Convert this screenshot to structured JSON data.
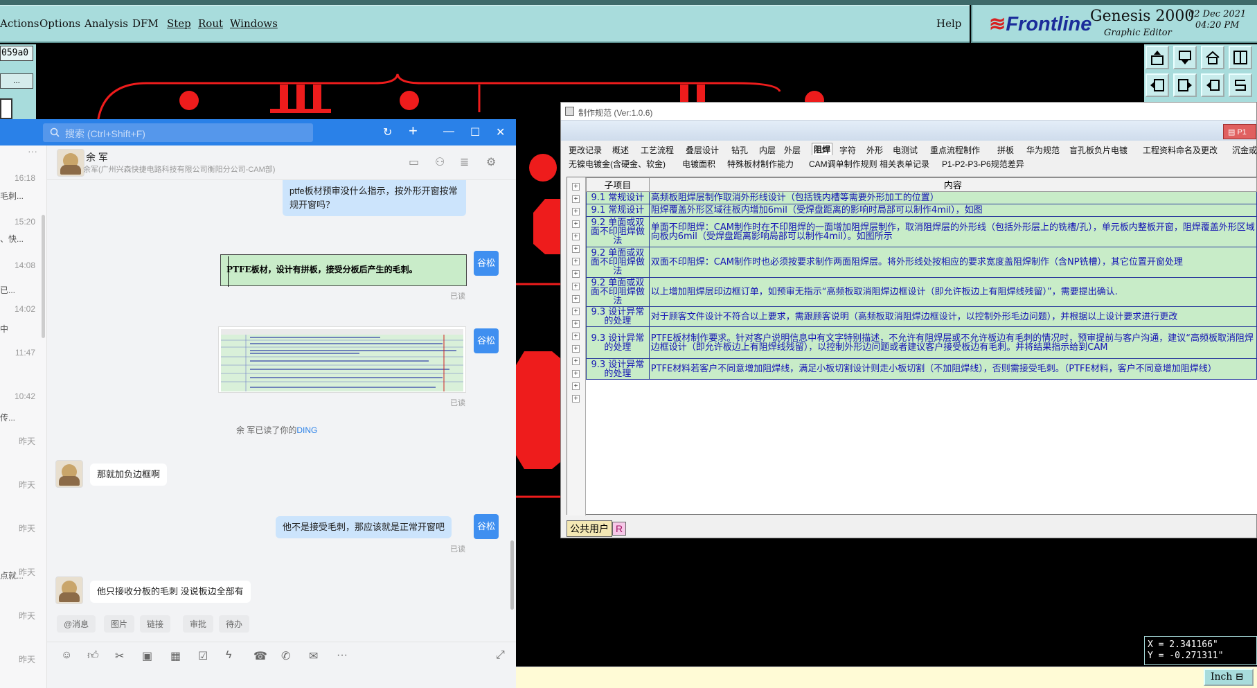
{
  "menu": {
    "items": [
      "Actions",
      "Options",
      "Analysis",
      "DFM",
      "Step",
      "Rout",
      "Windows"
    ],
    "help": "Help"
  },
  "brand": {
    "logo": "Frontline",
    "product": "Genesis 2000",
    "subtitle": "Graphic Editor",
    "date": "02 Dec 2021",
    "time": "04:20 PM"
  },
  "leftpanel": {
    "job_id": "059a0",
    "ellipsis": "..."
  },
  "coords": {
    "x": "X = 2.341166\"",
    "y": "Y = -0.271311\""
  },
  "units": "Inch",
  "spec": {
    "title": "制作规范 (Ver:1.0.6)",
    "p1": "P1",
    "tabs_row1": [
      "更改记录",
      "概述",
      "工艺流程",
      "叠层设计",
      "钻孔",
      "内层",
      "外层",
      "阻焊",
      "字符",
      "外形",
      "电测试",
      "重点流程制作",
      "拼板",
      "华为规范",
      "盲孔板负片电镀",
      "工程资料命名及更改",
      "沉金或化"
    ],
    "active_tab": "阻焊",
    "tabs_row2": [
      "无镍电镀金(含硬金、软金)",
      "电镀面积",
      "特殊板材制作能力",
      "CAM调单制作规则",
      "相关表单记录",
      "P1-P2-P3-P6规范差异"
    ],
    "columns": [
      "子项目",
      "内容"
    ],
    "rows": [
      {
        "item": "9.1 常规设计",
        "content": "高频板阻焊层制作取消外形线设计（包括铣内槽等需要外形加工的位置）"
      },
      {
        "item": "9.1 常规设计",
        "content": "阻焊覆盖外形区域往板内增加6mil（受焊盘距离的影响时局部可以制作4mil），如图"
      },
      {
        "item": "9.2 单面或双面不印阻焊做法",
        "content": "单面不印阻焊：CAM制作时在不印阻焊的一面增加阻焊层制作，取消阻焊层的外形线（包括外形层上的铣槽/孔），单元板内整板开窗，阻焊覆盖外形区域向板内6mil（受焊盘距离影响局部可以制作4mil）。如图所示"
      },
      {
        "item": "9.2 单面或双面不印阻焊做法",
        "content": "双面不印阻焊：CAM制作时也必须按要求制作两面阻焊层。将外形线处按相应的要求宽度盖阻焊制作（含NP铣槽），其它位置开窗处理"
      },
      {
        "item": "9.2 单面或双面不印阻焊做法",
        "content": "以上增加阻焊层印边框订单，如预审无指示“高频板取消阻焊边框设计（即允许板边上有阻焊线残留）”，需要提出确认."
      },
      {
        "item": "9.3 设计异常的处理",
        "content": "对于顾客文件设计不符合以上要求，需跟顾客说明（高频板取消阻焊边框设计，以控制外形毛边问题），并根据以上设计要求进行更改"
      },
      {
        "item": "9.3 设计异常的处理",
        "content": "PTFE板材制作要求。针对客户说明信息中有文字特别描述，不允许有阻焊层或不允许板边有毛刺的情况时，预审提前与客户沟通，建议“高频板取消阻焊边框设计（即允许板边上有阻焊线残留），以控制外形边问题或者建议客户接受板边有毛刺。并将结果指示给到CAM"
      },
      {
        "item": "9.3 设计异常的处理",
        "content": "PTFE材料若客户不同意增加阻焊线，满足小板切割设计则走小板切割（不加阻焊线），否则需接受毛刺。（PTFE材料，客户不同意增加阻焊线）"
      }
    ],
    "footer_user": "公共用户",
    "footer_r": "R"
  },
  "chat": {
    "search_placeholder": "搜索 (Ctrl+Shift+F)",
    "contact_name": "余 军",
    "contact_sub": "余军(广州兴森快捷电路科技有限公司衡阳分公司-CAM部)",
    "times": [
      "16:18",
      "15:20",
      "14:08",
      "14:02",
      "11:47",
      "10:42",
      "昨天",
      "昨天",
      "昨天",
      "昨天",
      "昨天",
      "昨天"
    ],
    "snippets": [
      "毛刺...",
      "、快...",
      "已...",
      "中",
      "传...",
      "点就..."
    ],
    "messages": {
      "m1": "ptfe板材预审没什么指示，按外形开窗按常规开窗吗？",
      "m2_image_text": "PTFE板材，设计有拼板，接受分板后产生的毛刺。",
      "m4": "那就加负边框啊",
      "m5": "他不是接受毛刺，那应该就是正常开窗吧",
      "m6": "他只接收分板的毛刺  没说板边全部有"
    },
    "me_label": "谷松",
    "read_label": "已读",
    "ding_prefix": "余 军已读了你的",
    "ding_word": "DING",
    "quick_actions": [
      "@消息",
      "图片",
      "链接",
      "审批",
      "待办"
    ]
  }
}
